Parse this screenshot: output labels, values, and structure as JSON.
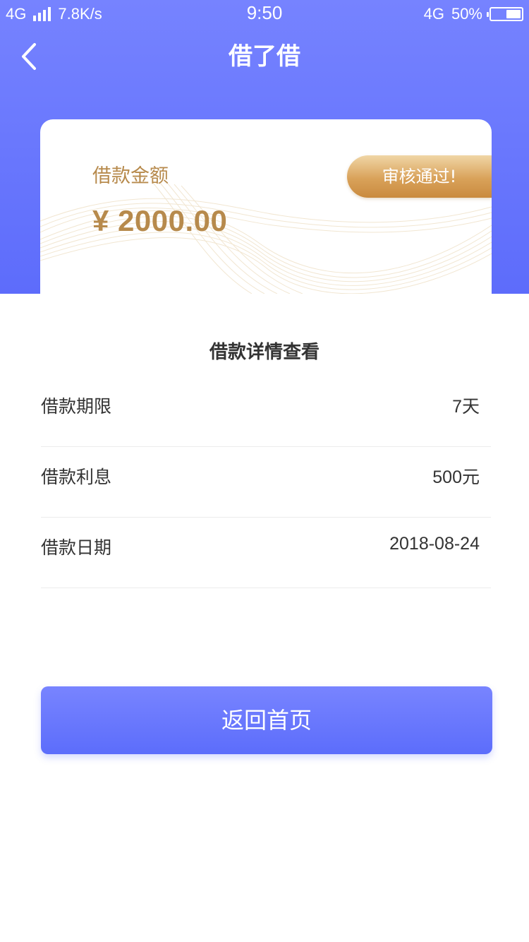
{
  "status_bar": {
    "network": "4G",
    "speed": "7.8K/s",
    "time": "9:50",
    "network_right": "4G",
    "battery_text": "50%",
    "battery_level": 0.5
  },
  "nav": {
    "title": "借了借",
    "back_icon": "chevron-left-icon"
  },
  "card": {
    "label": "借款金额",
    "amount": "¥ 2000.00",
    "badge": "审核通过!"
  },
  "details": {
    "title": "借款详情查看",
    "rows": [
      {
        "label": "借款期限",
        "value": "7天"
      },
      {
        "label": "借款利息",
        "value": "500元"
      },
      {
        "label": "借款日期",
        "value": "2018-08-24"
      }
    ]
  },
  "home_button": {
    "label": "返回首页"
  },
  "colors": {
    "primary": "#6675fd",
    "gold": "#b78a4c",
    "badge_gold": "#d9a25a",
    "text": "#333333",
    "divider": "#ececec"
  }
}
